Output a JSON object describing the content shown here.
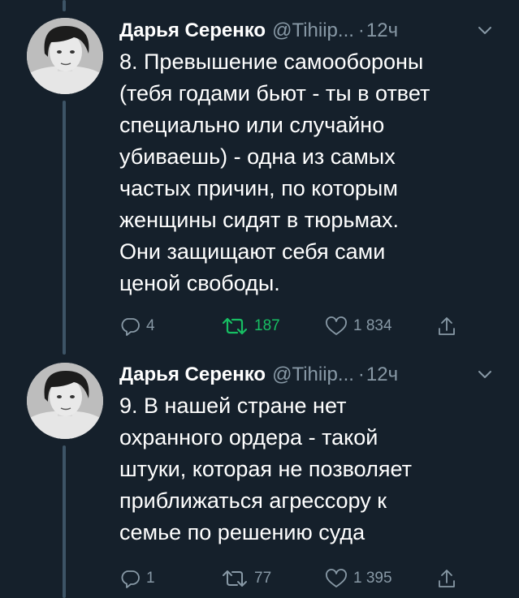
{
  "tweets": [
    {
      "author": {
        "name": "Дарья Серенко",
        "handle": "@Tihiip...",
        "separator": "·",
        "time": "12ч"
      },
      "text": "8. Превышение самообороны\n(тебя годами бьют - ты в ответ\nспециально или случайно\nубиваешь) - одна из самых\nчастых причин, по которым\nженщины сидят в тюрьмах.\nОни защищают себя сами\nценой свободы.",
      "stats": {
        "replies": "4",
        "retweets": "187",
        "likes": "1 834"
      },
      "retweeted": true
    },
    {
      "author": {
        "name": "Дарья Серенко",
        "handle": "@Tihiip...",
        "separator": "·",
        "time": "12ч"
      },
      "text": "9. В нашей стране нет\nохранного ордера - такой\nштуки, которая не позволяет\nприближаться агрессору к\nсемье по решению суда",
      "stats": {
        "replies": "1",
        "retweets": "77",
        "likes": "1 395"
      },
      "retweeted": false
    }
  ],
  "colors": {
    "background": "#15202b",
    "text": "#ffffff",
    "secondary": "#8899a6",
    "retweet_active": "#17bf63",
    "thread_line": "#3d5466"
  },
  "icons": {
    "reply": "reply-icon",
    "retweet": "retweet-icon",
    "like": "heart-icon",
    "share": "share-icon",
    "more": "chevron-down-icon"
  }
}
